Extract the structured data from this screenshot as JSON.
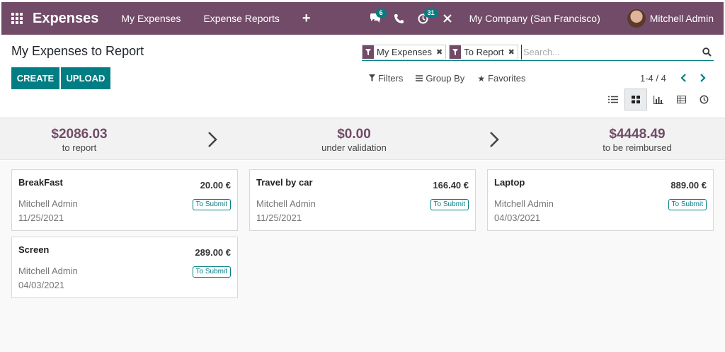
{
  "navbar": {
    "app_name": "Expenses",
    "menu": [
      "My Expenses",
      "Expense Reports"
    ],
    "plus": "+",
    "messages_badge": "6",
    "activities_badge": "31",
    "company": "My Company (San Francisco)",
    "user": "Mitchell Admin"
  },
  "page": {
    "title": "My Expenses to Report",
    "create_label": "CREATE",
    "upload_label": "UPLOAD"
  },
  "search": {
    "facets": [
      {
        "label": "My Expenses"
      },
      {
        "label": "To Report"
      }
    ],
    "placeholder": "Search..."
  },
  "filters": {
    "filters_label": "Filters",
    "groupby_label": "Group By",
    "favorites_label": "Favorites"
  },
  "pager": {
    "text": "1-4 / 4"
  },
  "dashboard": {
    "stats": [
      {
        "amount": "$2086.03",
        "label": "to report"
      },
      {
        "amount": "$0.00",
        "label": "under validation"
      },
      {
        "amount": "$4448.49",
        "label": "to be reimbursed"
      }
    ]
  },
  "cards": [
    {
      "name": "BreakFast",
      "amount": "20.00 €",
      "employee": "Mitchell Admin",
      "date": "11/25/2021",
      "status": "To Submit"
    },
    {
      "name": "Travel by car",
      "amount": "166.40 €",
      "employee": "Mitchell Admin",
      "date": "11/25/2021",
      "status": "To Submit"
    },
    {
      "name": "Laptop",
      "amount": "889.00 €",
      "employee": "Mitchell Admin",
      "date": "04/03/2021",
      "status": "To Submit"
    },
    {
      "name": "Screen",
      "amount": "289.00 €",
      "employee": "Mitchell Admin",
      "date": "04/03/2021",
      "status": "To Submit"
    }
  ],
  "colors": {
    "brand": "#714b67",
    "accent": "#017e84"
  }
}
